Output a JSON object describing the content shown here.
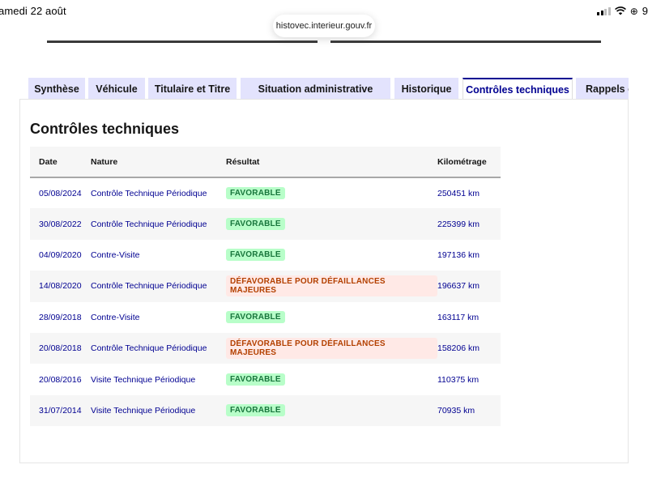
{
  "statusbar": {
    "date": "amedi 22 août",
    "battery": "9"
  },
  "browser": {
    "url": "histovec.interieur.gouv.fr"
  },
  "tabs": [
    {
      "label": "Synthèse",
      "active": false
    },
    {
      "label": "Véhicule",
      "active": false
    },
    {
      "label": "Titulaire et Titre",
      "active": false
    },
    {
      "label": "Situation administrative",
      "active": false
    },
    {
      "label": "Historique",
      "active": false
    },
    {
      "label": "Contrôles techniques",
      "active": true
    },
    {
      "label": "Rappels constructeur",
      "active": false
    }
  ],
  "panel": {
    "title": "Contrôles techniques",
    "columns": [
      "Date",
      "Nature",
      "Résultat",
      "Kilométrage"
    ],
    "rows": [
      {
        "date": "05/08/2024",
        "nature": "Contrôle Technique Périodique",
        "result": "FAVORABLE",
        "status": "ok",
        "km": "250451 km"
      },
      {
        "date": "30/08/2022",
        "nature": "Contrôle Technique Périodique",
        "result": "FAVORABLE",
        "status": "ok",
        "km": "225399 km"
      },
      {
        "date": "04/09/2020",
        "nature": "Contre-Visite",
        "result": "FAVORABLE",
        "status": "ok",
        "km": "197136 km"
      },
      {
        "date": "14/08/2020",
        "nature": "Contrôle Technique Périodique",
        "result": "DÉFAVORABLE POUR DÉFAILLANCES MAJEURES",
        "status": "ko",
        "km": "196637 km"
      },
      {
        "date": "28/09/2018",
        "nature": "Contre-Visite",
        "result": "FAVORABLE",
        "status": "ok",
        "km": "163117 km"
      },
      {
        "date": "20/08/2018",
        "nature": "Contrôle Technique Périodique",
        "result": "DÉFAVORABLE POUR DÉFAILLANCES MAJEURES",
        "status": "ko",
        "km": "158206 km"
      },
      {
        "date": "20/08/2016",
        "nature": "Visite Technique Périodique",
        "result": "FAVORABLE",
        "status": "ok",
        "km": "110375 km"
      },
      {
        "date": "31/07/2014",
        "nature": "Visite Technique Périodique",
        "result": "FAVORABLE",
        "status": "ok",
        "km": "70935 km"
      }
    ]
  },
  "colors": {
    "accent": "#000091",
    "tab_bg": "#e3e3fd",
    "ok_bg": "#b8fec9",
    "ok_text": "#18753c",
    "ko_bg": "#ffe9e6",
    "ko_text": "#b34000"
  },
  "icons": {
    "signal": "cellular-signal-icon",
    "wifi": "wifi-icon",
    "lock": "orientation-lock-icon"
  }
}
